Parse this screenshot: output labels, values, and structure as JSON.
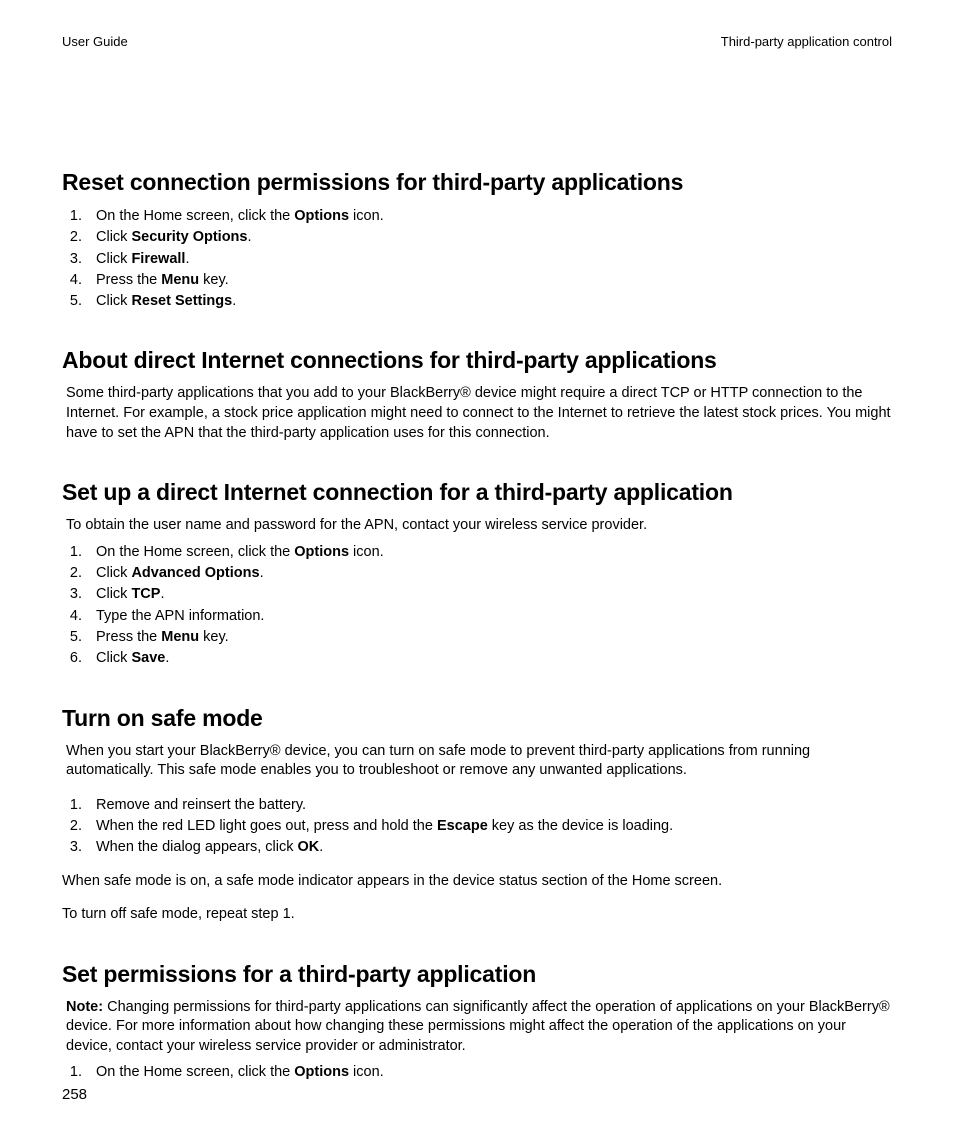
{
  "header": {
    "left": "User Guide",
    "right": "Third-party application control"
  },
  "sections": {
    "reset": {
      "title": "Reset connection permissions for third-party applications",
      "steps": [
        {
          "pre": "On the Home screen, click the ",
          "bold": "Options",
          "post": " icon."
        },
        {
          "pre": "Click ",
          "bold": "Security Options",
          "post": "."
        },
        {
          "pre": "Click ",
          "bold": "Firewall",
          "post": "."
        },
        {
          "pre": "Press the ",
          "bold": "Menu",
          "post": " key."
        },
        {
          "pre": "Click ",
          "bold": "Reset Settings",
          "post": "."
        }
      ]
    },
    "about": {
      "title": "About direct Internet connections for third-party applications",
      "para": "Some third-party applications that you add to your BlackBerry® device might require a direct TCP or HTTP connection to the Internet. For example, a stock price application might need to connect to the Internet to retrieve the latest stock prices. You might have to set the APN that the third-party application uses for this connection."
    },
    "setup": {
      "title": "Set up a direct Internet connection for a third-party application",
      "intro": "To obtain the user name and password for the APN, contact your wireless service provider.",
      "steps": [
        {
          "pre": "On the Home screen, click the ",
          "bold": "Options",
          "post": " icon."
        },
        {
          "pre": "Click ",
          "bold": "Advanced Options",
          "post": "."
        },
        {
          "pre": "Click ",
          "bold": "TCP",
          "post": "."
        },
        {
          "pre": "Type the APN information.",
          "bold": "",
          "post": ""
        },
        {
          "pre": "Press the ",
          "bold": "Menu",
          "post": " key."
        },
        {
          "pre": "Click ",
          "bold": "Save",
          "post": "."
        }
      ]
    },
    "safemode": {
      "title": "Turn on safe mode",
      "para": "When you start your BlackBerry® device, you can turn on safe mode to prevent third-party applications from running automatically. This safe mode enables you to troubleshoot or remove any unwanted applications.",
      "steps": [
        {
          "pre": "Remove and reinsert the battery.",
          "bold": "",
          "post": ""
        },
        {
          "pre": "When the red LED light goes out, press and hold the ",
          "bold": "Escape",
          "post": " key as the device is loading."
        },
        {
          "pre": "When the dialog appears, click ",
          "bold": "OK",
          "post": "."
        }
      ],
      "after1": "When safe mode is on, a safe mode indicator appears in the device status section of the Home screen.",
      "after2": "To turn off safe mode, repeat step 1."
    },
    "perms": {
      "title": "Set permissions for a third-party application",
      "note_label": "Note:",
      "note_body": "  Changing permissions for third-party applications can significantly affect the operation of applications on your BlackBerry® device. For more information about how changing these permissions might affect the operation of the applications on your device, contact your wireless service provider or administrator.",
      "steps": [
        {
          "pre": "On the Home screen, click the ",
          "bold": "Options",
          "post": " icon."
        }
      ]
    }
  },
  "page_number": "258"
}
